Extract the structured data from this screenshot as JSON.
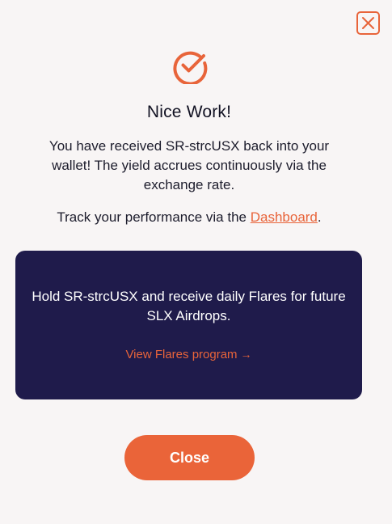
{
  "modal": {
    "title": "Nice Work!",
    "description": "You have received SR-strcUSX back into your wallet! The yield accrues continuously via the exchange rate.",
    "track_prefix": "Track your performance via the ",
    "track_link": "Dashboard",
    "track_suffix": ".",
    "close_label": "Close"
  },
  "promo": {
    "text": "Hold SR-strcUSX and receive daily Flares for future SLX Airdrops.",
    "link_label": "View Flares program",
    "link_arrow": "→"
  },
  "icons": {
    "close": "close-icon",
    "check": "check-circle-icon"
  },
  "colors": {
    "accent": "#e8643a",
    "promo_bg": "#1f1b4b",
    "background": "#f8f5f5"
  }
}
